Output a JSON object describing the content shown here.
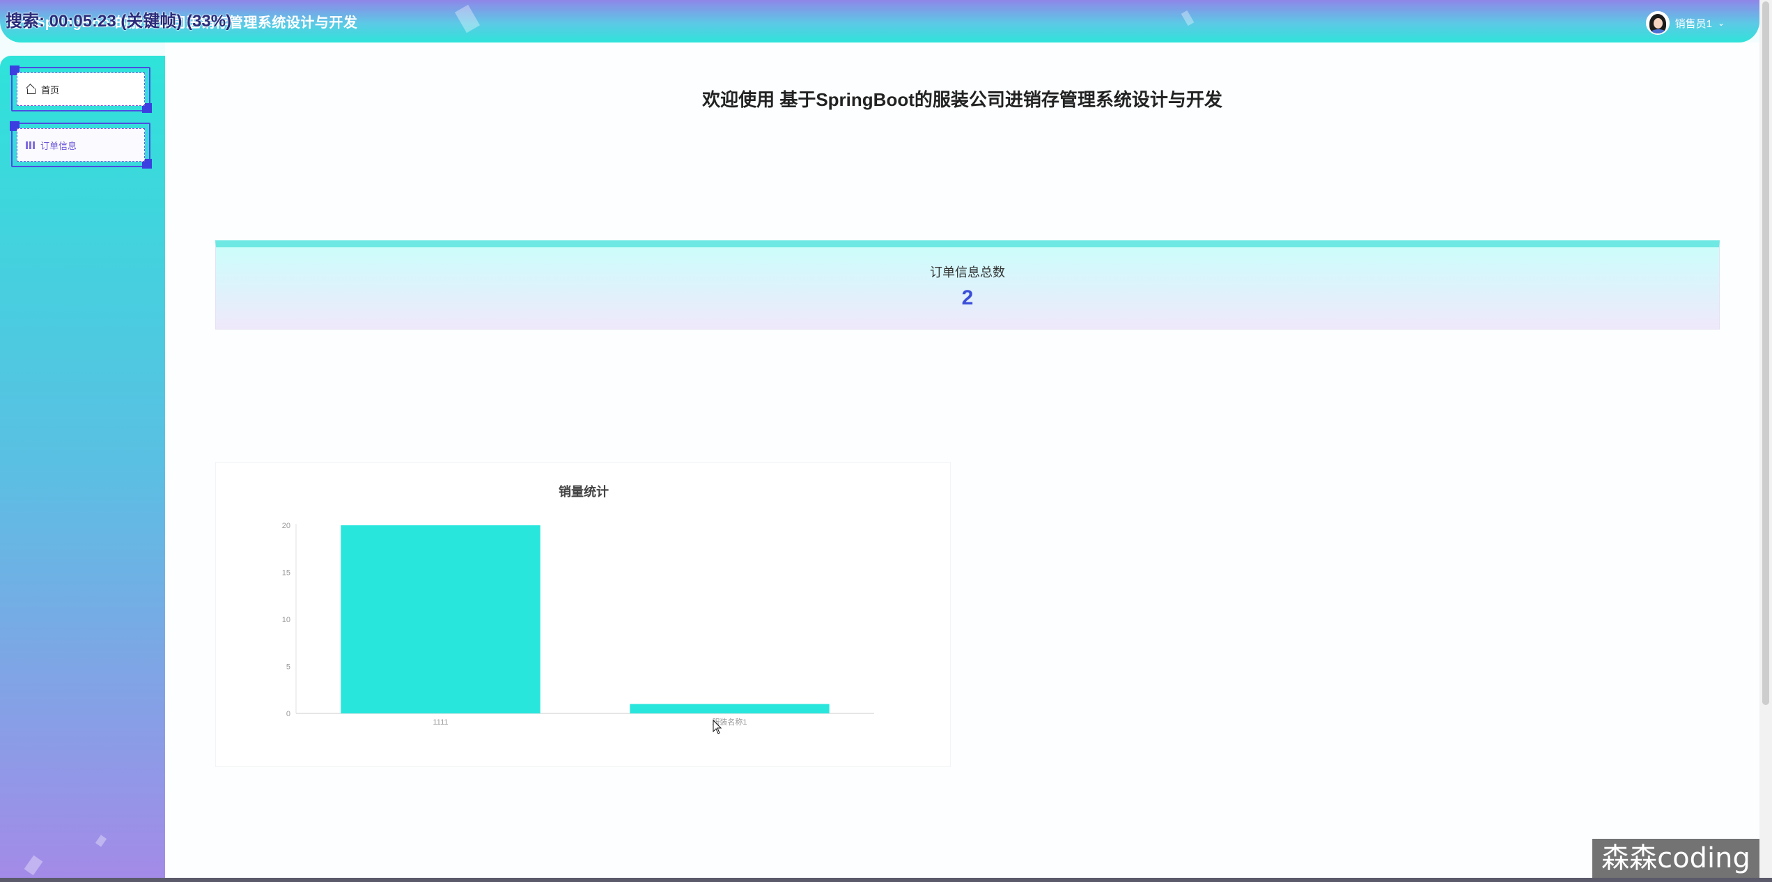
{
  "header": {
    "app_title": "基于SpringBoot的服装公司进销存管理系统设计与开发",
    "overlay_text": "搜索: 00:05:23 (关键帧) (33%)",
    "username": "销售员1"
  },
  "sidebar": {
    "items": [
      {
        "label": "首页",
        "icon": "home-icon"
      },
      {
        "label": "订单信息",
        "icon": "grid-icon"
      }
    ]
  },
  "main": {
    "welcome": "欢迎使用 基于SpringBoot的服装公司进销存管理系统设计与开发",
    "count_card": {
      "label": "订单信息总数",
      "value": "2"
    }
  },
  "chart_data": {
    "type": "bar",
    "title": "销量统计",
    "categories": [
      "1111",
      "服装名称1"
    ],
    "values": [
      20,
      1
    ],
    "ylim": [
      0,
      20
    ],
    "yticks": [
      0,
      5,
      10,
      15,
      20
    ],
    "bar_color": "#28e6dc",
    "grid": false
  },
  "watermark": "森森coding",
  "colors": {
    "accent": "#3b4ed8",
    "teal": "#28e6dc",
    "purple": "#8f86e8"
  }
}
